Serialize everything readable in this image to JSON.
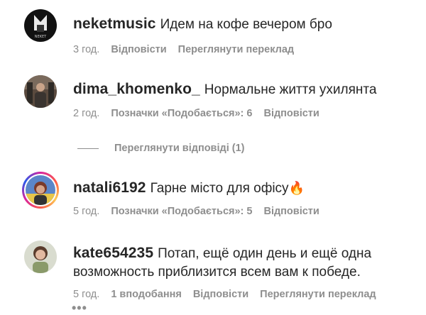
{
  "comments": [
    {
      "username": "neketmusic",
      "text": "Идем на кофе вечером бро",
      "time": "3 год.",
      "reply": "Відповісти",
      "translate": "Переглянути переклад"
    },
    {
      "username": "dima_khomenko_",
      "text": "Нормальне життя ухилянта",
      "time": "2 год.",
      "likes": "Позначки «Подобається»: 6",
      "reply": "Відповісти",
      "view_replies": "Переглянути відповіді (1)"
    },
    {
      "username": "natali6192",
      "text": "Гарне місто для офісу",
      "emoji": "🔥",
      "time": "5 год.",
      "likes": "Позначки «Подобається»: 5",
      "reply": "Відповісти"
    },
    {
      "username": "kate654235",
      "text_line1": "Потап, ещё один день и ещё одна",
      "text_line2": "возможность приблизится всем вам к победе.",
      "time": "5 год.",
      "likes": "1 вподобання",
      "reply": "Відповісти",
      "translate": "Переглянути переклад"
    }
  ],
  "more_icon": "•••",
  "colors": {
    "text": "#262626",
    "secondary": "#8e8e8e",
    "story_ring": "#d6249f"
  }
}
